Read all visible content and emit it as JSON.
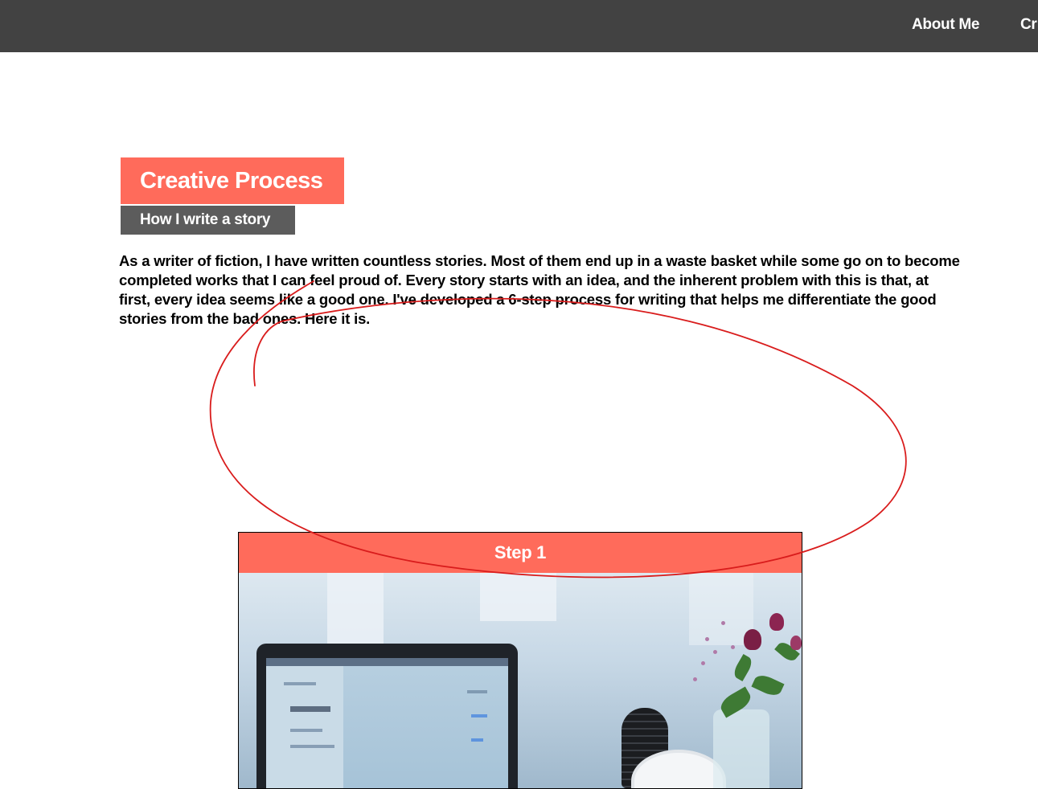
{
  "nav": {
    "items": [
      {
        "label": "About Me"
      },
      {
        "label": "Cr"
      }
    ]
  },
  "hero": {
    "title": "Creative Process",
    "subtitle": "How I write a story"
  },
  "intro": {
    "text": "As a writer of fiction, I have written countless stories. Most of them end up in a waste basket while some go on to become completed works that I can feel proud of. Every story starts with an idea, and the inherent problem with this is that, at first, every idea seems like a good one. I've developed a 6-step process for writing that helps me differentiate the good stories from the bad ones. Here it is."
  },
  "steps": [
    {
      "label": "Step 1",
      "image": "workspace-laptop-photo"
    }
  ],
  "colors": {
    "topbar": "#424242",
    "accent": "#ff6b5b",
    "subtitle_bg": "#5c5c5c",
    "annotation": "#d91c1c"
  }
}
